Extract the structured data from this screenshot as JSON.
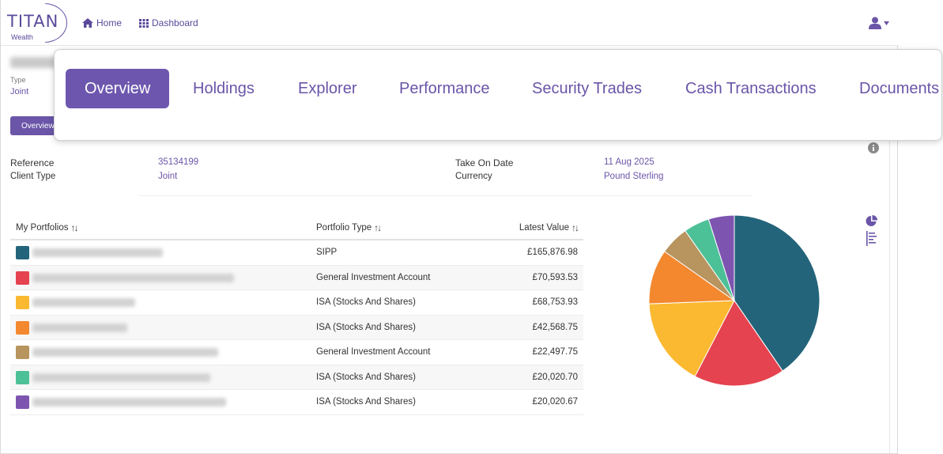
{
  "header": {
    "logo_text": "TITAN",
    "logo_subtext": "Wealth",
    "nav": [
      {
        "label": "Home",
        "icon": "home-icon"
      },
      {
        "label": "Dashboard",
        "icon": "grid-icon"
      }
    ],
    "user_icon": "user-icon"
  },
  "account": {
    "type_label": "Type",
    "type_value": "Joint",
    "overview_button": "Overview"
  },
  "tabs": [
    {
      "label": "Overview",
      "active": true
    },
    {
      "label": "Holdings",
      "active": false
    },
    {
      "label": "Explorer",
      "active": false
    },
    {
      "label": "Performance",
      "active": false
    },
    {
      "label": "Security Trades",
      "active": false
    },
    {
      "label": "Cash Transactions",
      "active": false
    },
    {
      "label": "Documents",
      "active": false
    }
  ],
  "info": {
    "reference_label": "Reference",
    "reference_value": "35134199",
    "client_type_label": "Client Type",
    "client_type_value": "Joint",
    "take_on_label": "Take On Date",
    "take_on_value": "11 Aug 2025",
    "currency_label": "Currency",
    "currency_value": "Pound Sterling"
  },
  "table": {
    "headers": {
      "portfolios": "My Portfolios",
      "type": "Portfolio Type",
      "value": "Latest Value"
    },
    "rows": [
      {
        "color": "#23647a",
        "type": "SIPP",
        "value": "£165,876.98"
      },
      {
        "color": "#e5434f",
        "type": "General Investment Account",
        "value": "£70,593.53"
      },
      {
        "color": "#fbb931",
        "type": "ISA (Stocks And Shares)",
        "value": "£68,753.93"
      },
      {
        "color": "#f3882f",
        "type": "ISA (Stocks And Shares)",
        "value": "£42,568.75"
      },
      {
        "color": "#b8945e",
        "type": "General Investment Account",
        "value": "£22,497.75"
      },
      {
        "color": "#4cc096",
        "type": "ISA (Stocks And Shares)",
        "value": "£20,020.70"
      },
      {
        "color": "#7d55b1",
        "type": "ISA (Stocks And Shares)",
        "value": "£20,020.67"
      }
    ]
  },
  "chart_data": {
    "type": "pie",
    "categories": [
      "SIPP",
      "General Investment Account",
      "ISA (Stocks And Shares)",
      "ISA (Stocks And Shares)",
      "General Investment Account",
      "ISA (Stocks And Shares)",
      "ISA (Stocks And Shares)"
    ],
    "values": [
      165876.98,
      70593.53,
      68753.93,
      42568.75,
      22497.75,
      20020.7,
      20020.67
    ],
    "colors": [
      "#23647a",
      "#e5434f",
      "#fbb931",
      "#f3882f",
      "#b8945e",
      "#4cc096",
      "#7d55b1"
    ]
  },
  "side_icons": [
    "pie-chart-icon",
    "list-icon"
  ],
  "info_icon": "info-icon",
  "colors": {
    "accent": "#6a55a8"
  }
}
